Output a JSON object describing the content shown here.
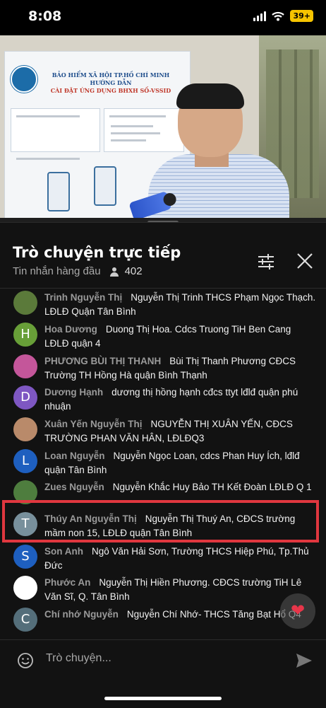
{
  "status_bar": {
    "time": "8:08",
    "battery": "39+"
  },
  "video": {
    "banner_title_1": "BẢO HIỂM XÃ HỘI TP.HỒ CHÍ MINH",
    "banner_title_2": "HƯỚNG DẪN",
    "banner_title_3": "CÀI ĐẶT ỨNG DỤNG BHXH SỐ-VSSID"
  },
  "chat": {
    "title": "Trò chuyện trực tiếp",
    "filter_label": "Tin nhắn hàng đầu",
    "viewer_count": "402",
    "messages": [
      {
        "author": "Trinh Nguyễn Thị",
        "text": "Nguyễn Thị Trinh THCS Phạm Ngọc Thạch. LĐLĐ Quận Tân Bình",
        "avatar_letter": "",
        "avatar_color": "#5b7a3a"
      },
      {
        "author": "Hoa Dương",
        "text": "Duong Thị Hoa. Cdcs Truong TiH Ben Cang LĐLĐ quận 4",
        "avatar_letter": "H",
        "avatar_color": "#689f38"
      },
      {
        "author": "PHƯƠNG BÙI THỊ THANH",
        "text": "Bùi Thị Thanh Phương CĐCS Trường TH Hồng Hà quận Bình Thạnh",
        "avatar_letter": "",
        "avatar_color": "#c4569a"
      },
      {
        "author": "Dương Hạnh",
        "text": "dương thị hồng hạnh cđcs ttyt lđlđ quận phú nhuận",
        "avatar_letter": "D",
        "avatar_color": "#7e57c2"
      },
      {
        "author": "Xuân Yến Nguyễn Thị",
        "text": "NGUYỄN THỊ XUÂN YẾN, CĐCS TRƯỜNG PHAN VĂN HÂN, LĐLĐQ3",
        "avatar_letter": "",
        "avatar_color": "#b98a6a"
      },
      {
        "author": "Loan Nguyễn",
        "text": "Nguyễn Ngọc Loan, cdcs Phan Huy Ích, lđlđ quận Tân Bình",
        "avatar_letter": "L",
        "avatar_color": "#1e5fbf"
      },
      {
        "author": "Zues Nguyễn",
        "text": "Nguyễn Khắc Huy Bảo TH Kết Đoàn LĐLĐ Q 1",
        "avatar_letter": "",
        "avatar_color": "#4e7d3e"
      },
      {
        "author": "Thúy An Nguyễn Thị",
        "text": "Nguyễn Thị Thuý An, CĐCS trường mầm non 15, LĐLĐ quận Tân Bình",
        "avatar_letter": "T",
        "avatar_color": "#78909c"
      },
      {
        "author": "Son Anh",
        "text": "Ngô Văn Hải Sơn, Trường THCS Hiệp Phú, Tp.Thủ Đức",
        "avatar_letter": "S",
        "avatar_color": "#1e5fbf"
      },
      {
        "author": "Phước An",
        "text": "Nguyễn Thị Hiền Phương. CĐCS trường TiH Lê Văn Sĩ, Q. Tân Bình",
        "avatar_letter": "",
        "avatar_color": "#ffffff"
      },
      {
        "author": "Chí nhớ Nguyễn",
        "text": "Nguyễn Chí Nhớ- THCS Tăng Bạt Hổ Q4",
        "avatar_letter": "C",
        "avatar_color": "#546e7a"
      }
    ],
    "input_placeholder": "Trò chuyện...",
    "heart": "❤"
  }
}
